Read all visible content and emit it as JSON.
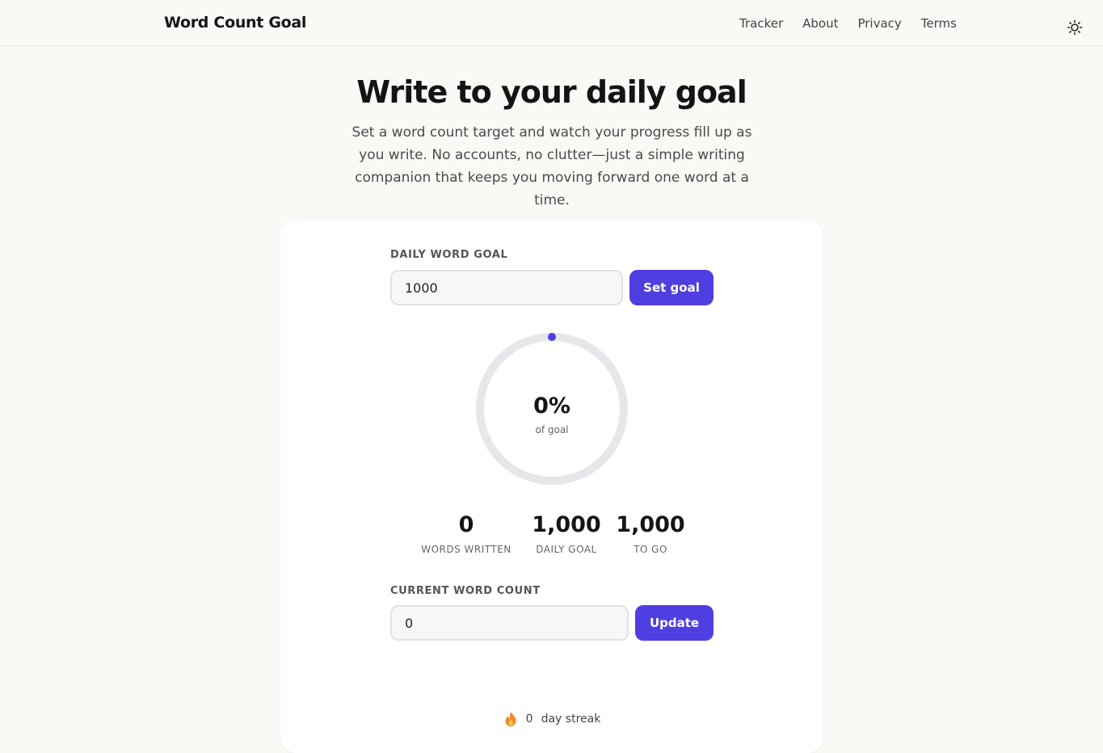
{
  "header": {
    "brand": "Word Count Goal",
    "nav": [
      "Tracker",
      "About",
      "Privacy",
      "Terms"
    ],
    "theme_icon": "sun-icon"
  },
  "hero": {
    "title": "Write to your daily goal",
    "subtitle": "Set a word count target and watch your progress fill up as you write. No accounts, no clutter—just a simple writing companion that keeps you moving forward one word at a time."
  },
  "goal_form": {
    "label": "DAILY WORD GOAL",
    "value": "1000",
    "button": "Set goal"
  },
  "progress": {
    "percent_label": "0%",
    "caption": "of goal",
    "fraction": 0,
    "accent": "#4f3fe0",
    "track": "#e6e7ea"
  },
  "stats": [
    {
      "value": "0",
      "label": "WORDS WRITTEN"
    },
    {
      "value": "1,000",
      "label": "DAILY GOAL"
    },
    {
      "value": "1,000",
      "label": "TO GO"
    }
  ],
  "count_form": {
    "label": "CURRENT WORD COUNT",
    "value": "0",
    "button": "Update"
  },
  "streak": {
    "count": "0",
    "label": "day streak",
    "icon": "flame-icon"
  }
}
